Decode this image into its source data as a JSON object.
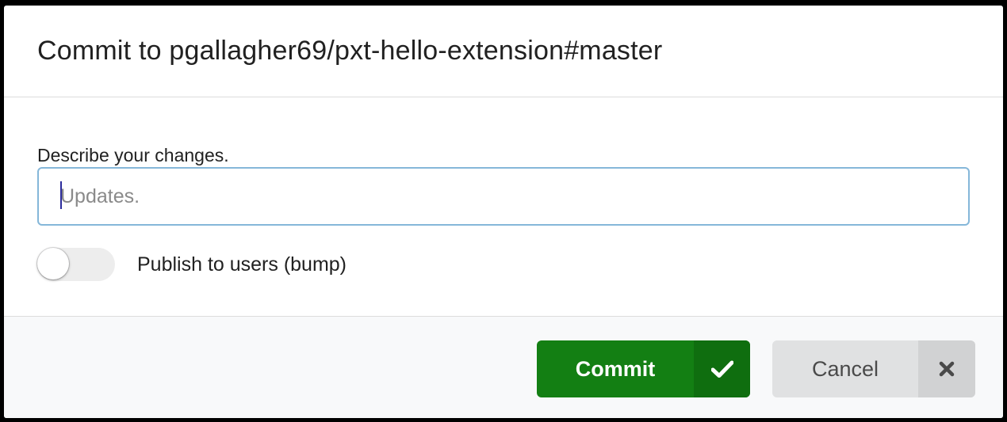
{
  "dialog": {
    "title": "Commit to pgallagher69/pxt-hello-extension#master"
  },
  "form": {
    "description_label": "Describe your changes.",
    "description_value": "",
    "description_placeholder": "Updates.",
    "publish_toggle": {
      "label": "Publish to users (bump)",
      "checked": false
    }
  },
  "actions": {
    "commit_label": "Commit",
    "commit_icon": "checkmark-icon",
    "cancel_label": "Cancel",
    "cancel_icon": "close-icon"
  },
  "colors": {
    "commit_button": "#137f13",
    "commit_icon_bg": "#0f6e0f",
    "cancel_button": "#e0e1e2",
    "cancel_icon_bg": "#d1d2d3",
    "input_focus_border": "#85b7d9",
    "footer_bg": "#f8f9fa"
  }
}
